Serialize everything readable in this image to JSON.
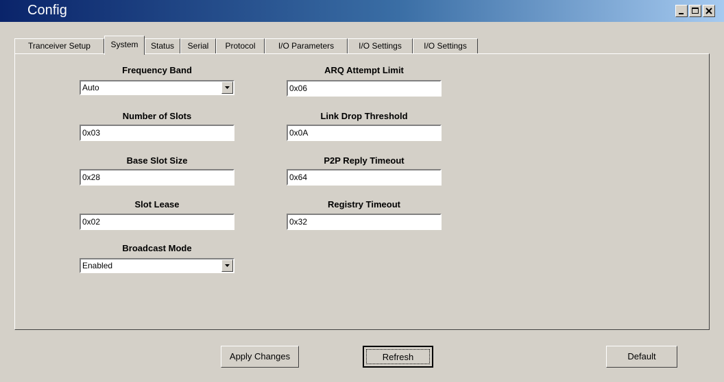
{
  "window": {
    "title": "Config"
  },
  "tabs": [
    {
      "label": "Tranceiver Setup"
    },
    {
      "label": "System"
    },
    {
      "label": "Status"
    },
    {
      "label": "Serial"
    },
    {
      "label": "Protocol"
    },
    {
      "label": "I/O Parameters"
    },
    {
      "label": "I/O Settings"
    },
    {
      "label": "I/O Settings"
    }
  ],
  "active_tab": "System",
  "fields": {
    "frequency_band": {
      "label": "Frequency Band",
      "value": "Auto"
    },
    "number_of_slots": {
      "label": "Number of Slots",
      "value": "0x03"
    },
    "base_slot_size": {
      "label": "Base Slot Size",
      "value": "0x28"
    },
    "slot_lease": {
      "label": "Slot Lease",
      "value": "0x02"
    },
    "broadcast_mode": {
      "label": "Broadcast Mode",
      "value": "Enabled"
    },
    "arq_attempt_limit": {
      "label": "ARQ Attempt Limit",
      "value": "0x06"
    },
    "link_drop_threshold": {
      "label": "Link Drop Threshold",
      "value": "0x0A"
    },
    "p2p_reply_timeout": {
      "label": "P2P Reply Timeout",
      "value": "0x64"
    },
    "registry_timeout": {
      "label": "Registry Timeout",
      "value": "0x32"
    }
  },
  "buttons": {
    "apply": "Apply Changes",
    "refresh": "Refresh",
    "default": "Default"
  }
}
